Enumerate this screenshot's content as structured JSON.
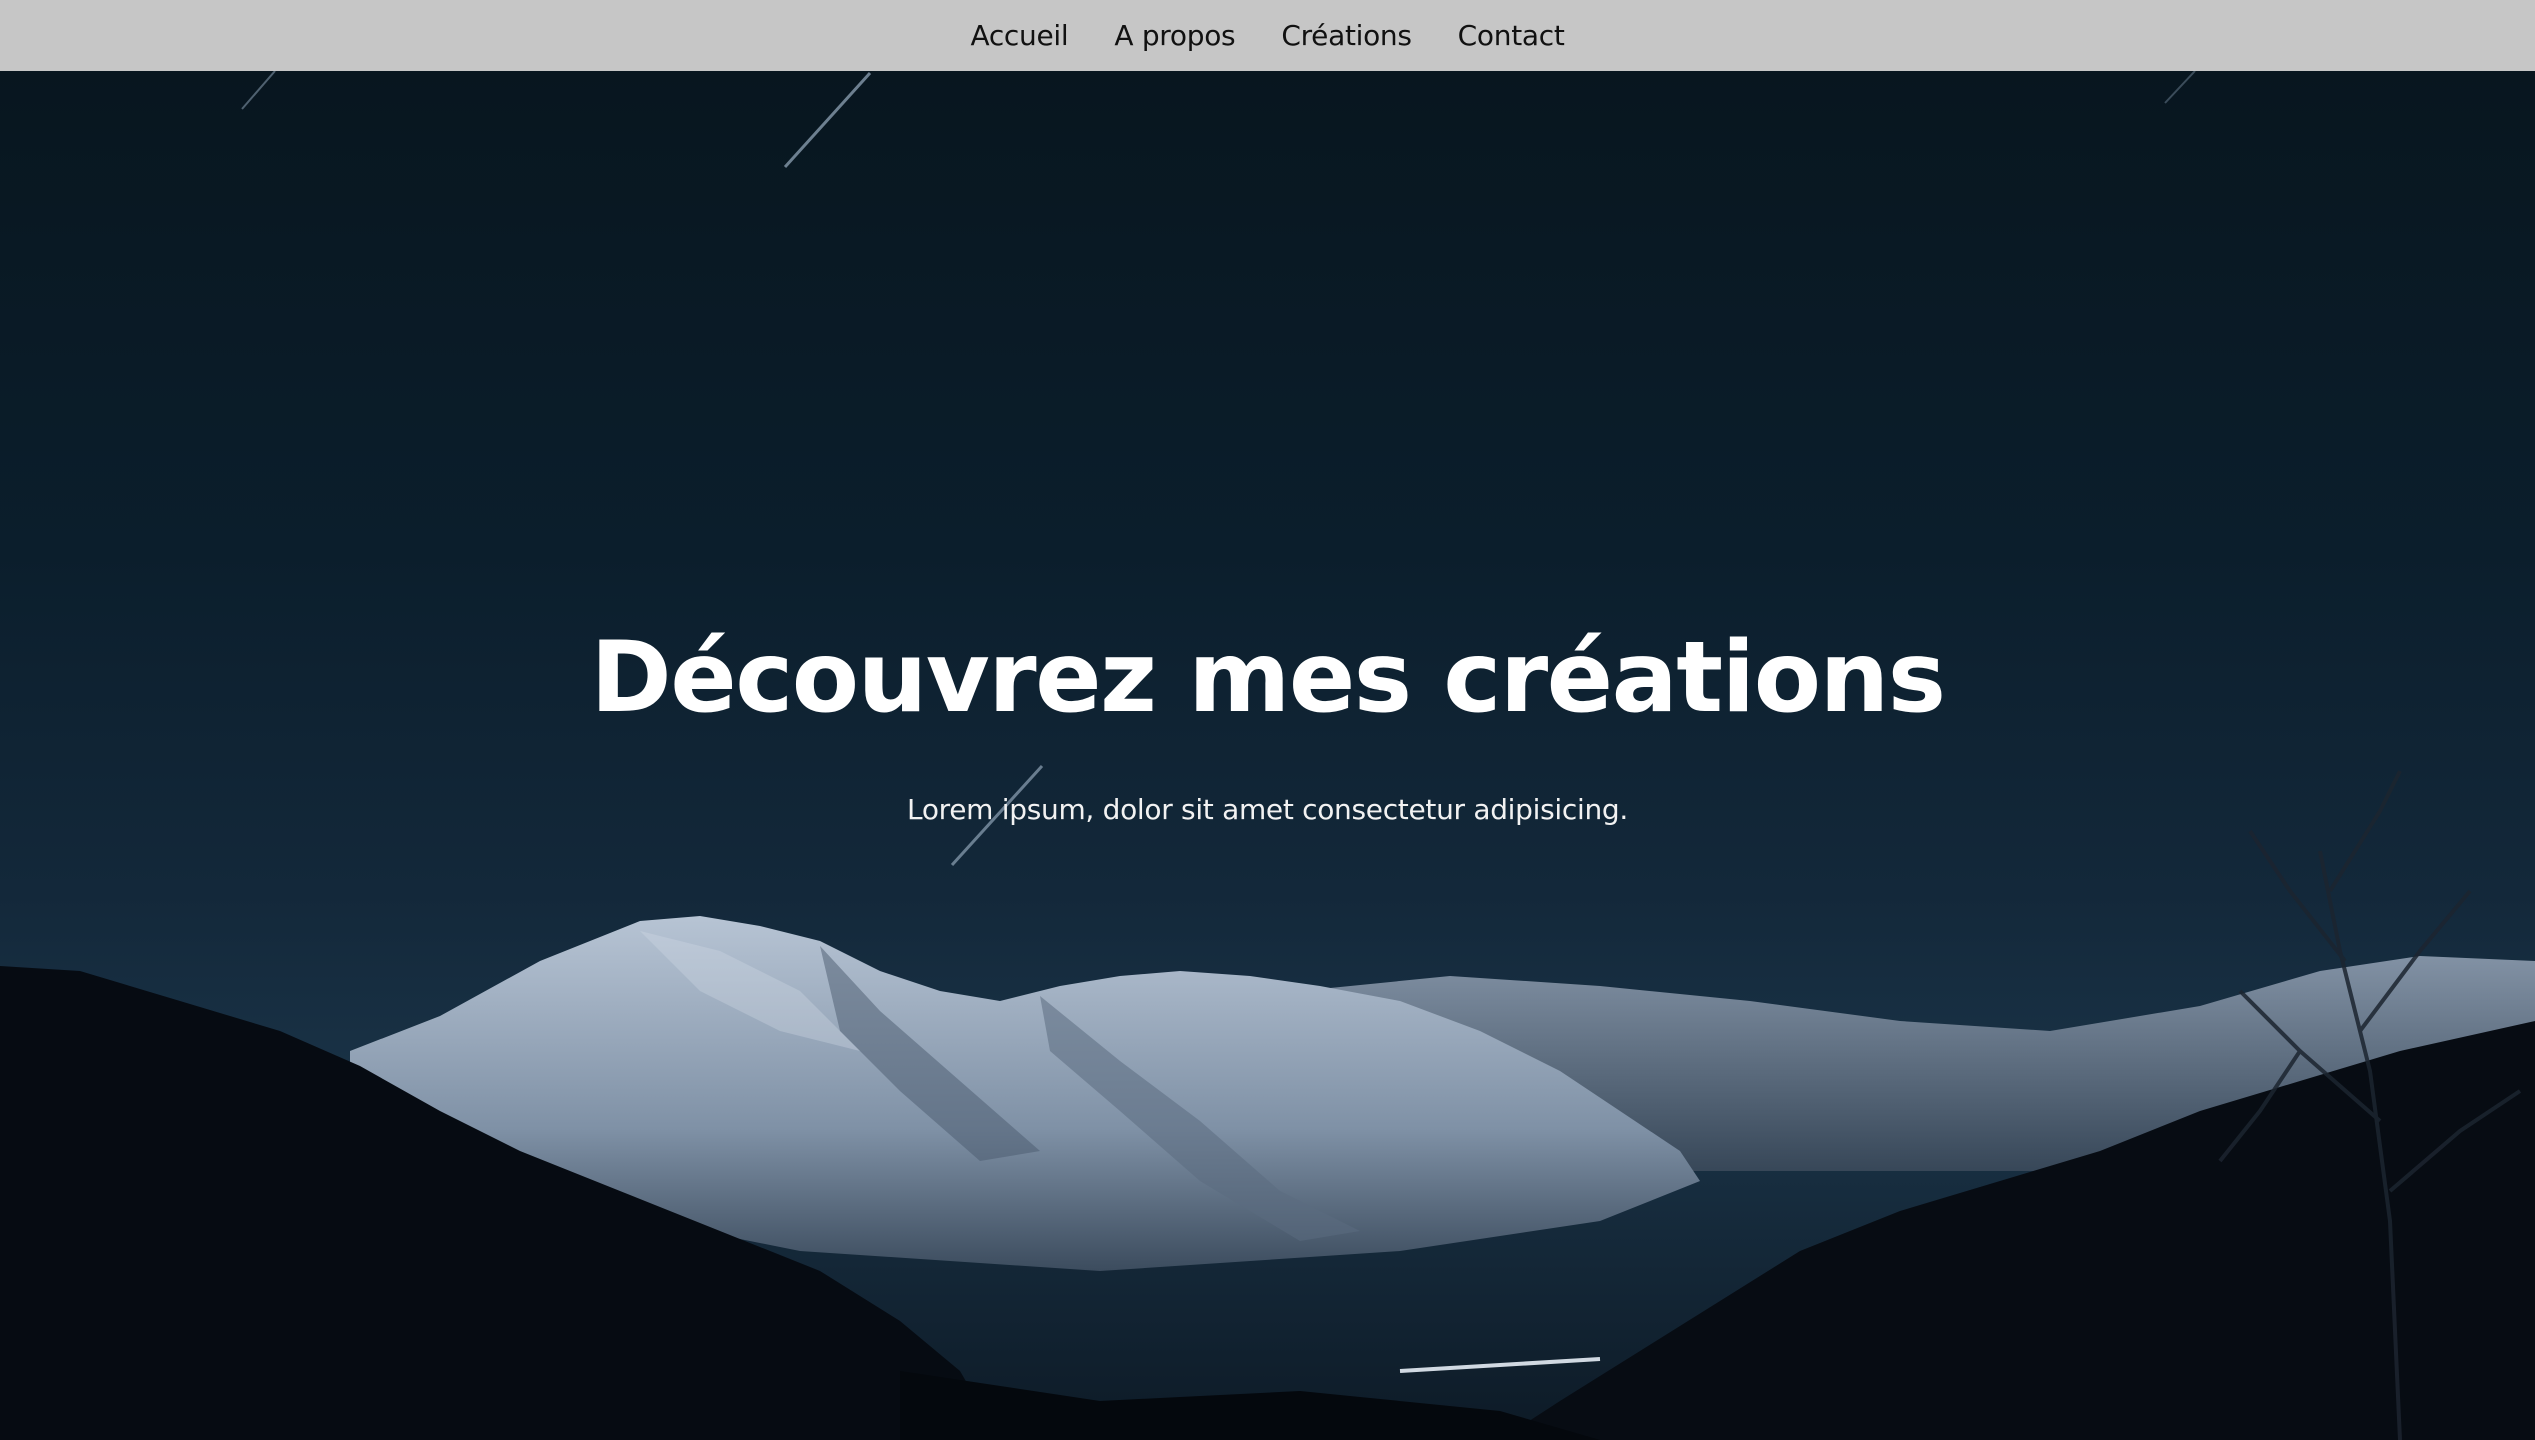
{
  "nav": {
    "items": [
      {
        "label": "Accueil"
      },
      {
        "label": "A propos"
      },
      {
        "label": "Créations"
      },
      {
        "label": "Contact"
      }
    ]
  },
  "hero": {
    "title": "Découvrez mes créations",
    "subtitle": "Lorem ipsum, dolor sit amet consectetur adipisicing."
  },
  "colors": {
    "nav_background": "#c6c6c6",
    "sky_dark": "#08161f",
    "snow": "#9aa9bb",
    "forest": "#05090e",
    "text_light": "#ffffff"
  }
}
